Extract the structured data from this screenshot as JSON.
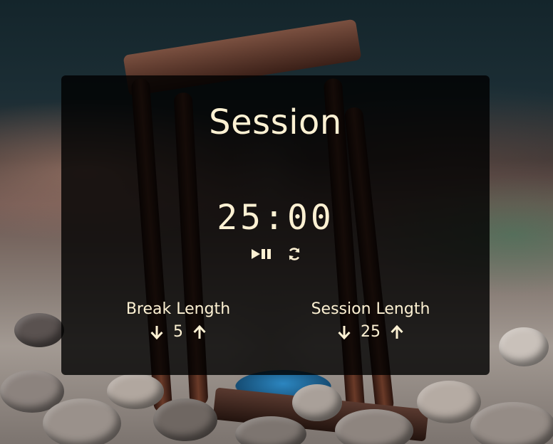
{
  "timer": {
    "label": "Session",
    "time": "25:00"
  },
  "controls": {
    "play_pause_icon": "play-pause-icon",
    "reset_icon": "refresh-icon"
  },
  "break_length": {
    "label": "Break Length",
    "value": "5"
  },
  "session_length": {
    "label": "Session Length",
    "value": "25"
  },
  "colors": {
    "text": "#fdf1d3",
    "card_bg": "rgba(0,0,0,0.80)"
  }
}
